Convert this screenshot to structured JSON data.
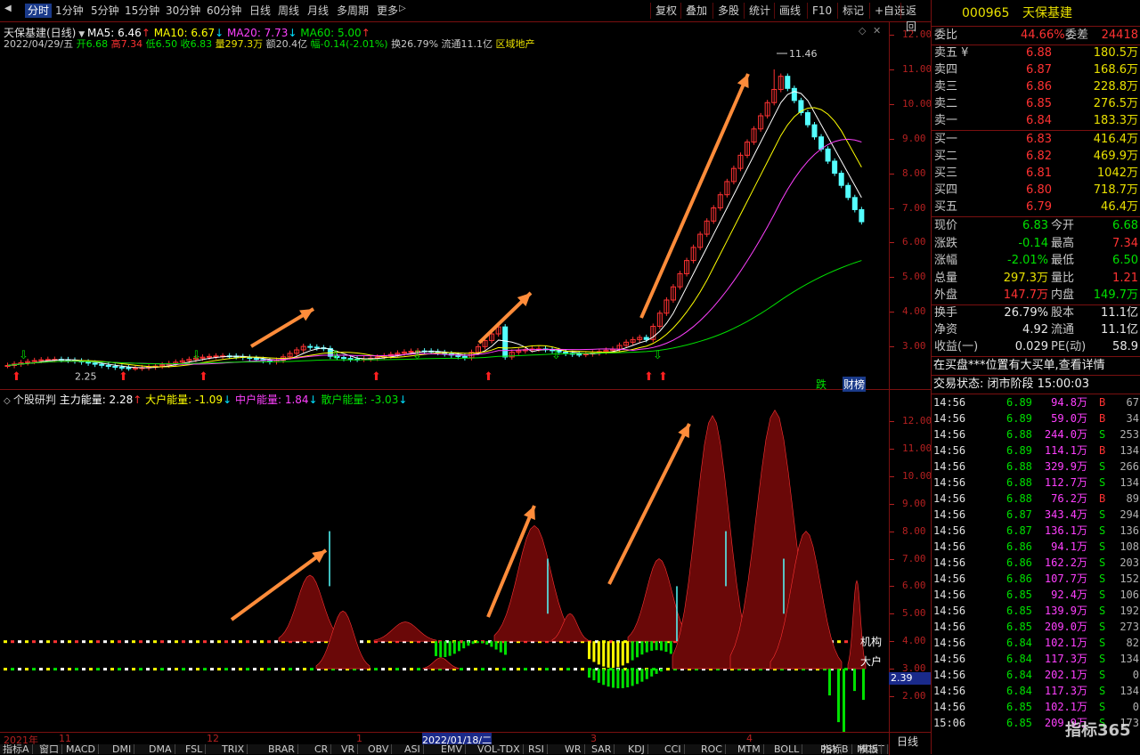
{
  "toolbar": {
    "periods": [
      "分时",
      "1分钟",
      "5分钟",
      "15分钟",
      "30分钟",
      "60分钟",
      "日线",
      "周线",
      "月线",
      "多周期",
      "更多"
    ],
    "active_period": "分时",
    "buttons": [
      "复权",
      "叠加",
      "多股",
      "统计",
      "画线",
      "F10",
      "标记",
      "+自选",
      "返回"
    ]
  },
  "chart": {
    "title": "天保基建(日线)",
    "ma": [
      {
        "label": "MA5: 6.46",
        "arrow": "↑",
        "color": "#ffffff"
      },
      {
        "label": "MA10: 6.67",
        "arrow": "↓",
        "color": "#ffff00"
      },
      {
        "label": "MA20: 7.73",
        "arrow": "↓",
        "color": "#ff40ff"
      },
      {
        "label": "MA60: 5.00",
        "arrow": "↑",
        "color": "#00e000"
      }
    ],
    "info": [
      {
        "t": "2022/04/29/五 ",
        "c": "#c8c8c8"
      },
      {
        "t": "开6.68 ",
        "c": "#00e000"
      },
      {
        "t": "高7.34 ",
        "c": "#ff3232"
      },
      {
        "t": "低6.50 ",
        "c": "#00e000"
      },
      {
        "t": "收6.83 ",
        "c": "#00e000"
      },
      {
        "t": "量297.3万 ",
        "c": "#e8e000"
      },
      {
        "t": "额20.4亿 ",
        "c": "#c8c8c8"
      },
      {
        "t": "幅-0.14(-2.01%) ",
        "c": "#00e000"
      },
      {
        "t": "换26.79% ",
        "c": "#c8c8c8"
      },
      {
        "t": "流通11.1亿 ",
        "c": "#c8c8c8"
      },
      {
        "t": "区域地产",
        "c": "#e8e000"
      }
    ],
    "price_ticks": [
      "12.00",
      "11.00",
      "10.00",
      "9.00",
      "8.00",
      "7.00",
      "6.00",
      "5.00",
      "4.00",
      "3.00"
    ],
    "high_label": "11.46",
    "low_label": "2.25",
    "tag_die": "跌",
    "tag_bang": "财榜"
  },
  "indicator": {
    "name": "个股研判",
    "lines": [
      {
        "label": "主力能量: 2.28",
        "arrow": "↑",
        "color": "#ffffff"
      },
      {
        "label": "大户能量: -1.09",
        "arrow": "↓",
        "color": "#ffff00"
      },
      {
        "label": "中户能量: 1.84",
        "arrow": "↓",
        "color": "#ff40ff"
      },
      {
        "label": "散户能量: -3.03",
        "arrow": "↓",
        "color": "#00e000"
      }
    ],
    "ticks": [
      "12.00",
      "11.00",
      "10.00",
      "9.00",
      "8.00",
      "7.00",
      "6.00",
      "5.00",
      "4.00",
      "3.00",
      "2.00"
    ],
    "label_jigou": "机构",
    "label_dahu": "大户",
    "current_value": "2.39"
  },
  "date_axis": {
    "ticks": [
      "2021年",
      "11",
      "12",
      "1",
      "2022/01/18/二",
      "3",
      "4"
    ],
    "right_label": "日线"
  },
  "indicator_tabs": [
    "指标A",
    "窗口",
    "MACD",
    "DMI",
    "DMA",
    "FSL",
    "TRIX",
    "BRAR",
    "CR",
    "VR",
    "OBV",
    "ASI",
    "EMV",
    "VOL-TDX",
    "RSI",
    "WR",
    "SAR",
    "KDJ",
    "CCI",
    "ROC",
    "MTM",
    "BOLL",
    "PSY",
    "MCST",
    "更多",
    "设置",
    "指标B",
    "模板"
  ],
  "quote": {
    "code": "000965",
    "name": "天保基建",
    "weibi_label": "委比",
    "weibi_value": "44.66%",
    "weicha_label": "委差",
    "weicha_value": "24418",
    "sell": [
      {
        "label": "卖五 ¥",
        "price": "6.88",
        "vol": "180.5万"
      },
      {
        "label": "卖四",
        "price": "6.87",
        "vol": "168.6万"
      },
      {
        "label": "卖三",
        "price": "6.86",
        "vol": "228.8万"
      },
      {
        "label": "卖二",
        "price": "6.85",
        "vol": "276.5万"
      },
      {
        "label": "卖一",
        "price": "6.84",
        "vol": "183.3万"
      }
    ],
    "buy": [
      {
        "label": "买一",
        "price": "6.83",
        "vol": "416.4万"
      },
      {
        "label": "买二",
        "price": "6.82",
        "vol": "469.9万"
      },
      {
        "label": "买三",
        "price": "6.81",
        "vol": "1042万"
      },
      {
        "label": "买四",
        "price": "6.80",
        "vol": "718.7万"
      },
      {
        "label": "买五",
        "price": "6.79",
        "vol": "46.4万"
      }
    ],
    "stats": [
      {
        "l1": "现价",
        "v1": "6.83",
        "c1": "#00e000",
        "l2": "今开",
        "v2": "6.68",
        "c2": "#00e000"
      },
      {
        "l1": "涨跌",
        "v1": "-0.14",
        "c1": "#00e000",
        "l2": "最高",
        "v2": "7.34",
        "c2": "#ff3232"
      },
      {
        "l1": "涨幅",
        "v1": "-2.01%",
        "c1": "#00e000",
        "l2": "最低",
        "v2": "6.50",
        "c2": "#00e000"
      },
      {
        "l1": "总量",
        "v1": "297.3万",
        "c1": "#e8e000",
        "l2": "量比",
        "v2": "1.21",
        "c2": "#ff3232"
      },
      {
        "l1": "外盘",
        "v1": "147.7万",
        "c1": "#ff3232",
        "l2": "内盘",
        "v2": "149.7万",
        "c2": "#00e000"
      }
    ],
    "stats2": [
      {
        "l1": "换手",
        "v1": "26.79%",
        "l2": "股本",
        "v2": "11.1亿"
      },
      {
        "l1": "净资",
        "v1": "4.92",
        "l2": "流通",
        "v2": "11.1亿"
      },
      {
        "l1": "收益(一)",
        "v1": "0.029",
        "l2": "PE(动)",
        "v2": "58.9"
      }
    ],
    "notice": "在买盘***位置有大买单,查看详情",
    "trade_status": "交易状态: 闭市阶段 15:00:03",
    "ticks": [
      {
        "t": "14:56",
        "p": "6.89",
        "v": "94.8万",
        "bs": "B",
        "n": "67"
      },
      {
        "t": "14:56",
        "p": "6.89",
        "v": "59.0万",
        "bs": "B",
        "n": "34"
      },
      {
        "t": "14:56",
        "p": "6.88",
        "v": "244.0万",
        "bs": "S",
        "n": "253"
      },
      {
        "t": "14:56",
        "p": "6.89",
        "v": "114.1万",
        "bs": "B",
        "n": "134"
      },
      {
        "t": "14:56",
        "p": "6.88",
        "v": "329.9万",
        "bs": "S",
        "n": "266"
      },
      {
        "t": "14:56",
        "p": "6.88",
        "v": "112.7万",
        "bs": "S",
        "n": "134"
      },
      {
        "t": "14:56",
        "p": "6.88",
        "v": "76.2万",
        "bs": "B",
        "n": "89"
      },
      {
        "t": "14:56",
        "p": "6.87",
        "v": "343.4万",
        "bs": "S",
        "n": "294"
      },
      {
        "t": "14:56",
        "p": "6.87",
        "v": "136.1万",
        "bs": "S",
        "n": "136"
      },
      {
        "t": "14:56",
        "p": "6.86",
        "v": "94.1万",
        "bs": "S",
        "n": "108"
      },
      {
        "t": "14:56",
        "p": "6.86",
        "v": "162.2万",
        "bs": "S",
        "n": "203"
      },
      {
        "t": "14:56",
        "p": "6.86",
        "v": "107.7万",
        "bs": "S",
        "n": "152"
      },
      {
        "t": "14:56",
        "p": "6.85",
        "v": "92.4万",
        "bs": "S",
        "n": "106"
      },
      {
        "t": "14:56",
        "p": "6.85",
        "v": "139.9万",
        "bs": "S",
        "n": "192"
      },
      {
        "t": "14:56",
        "p": "6.85",
        "v": "209.0万",
        "bs": "S",
        "n": "273"
      },
      {
        "t": "14:56",
        "p": "6.84",
        "v": "102.1万",
        "bs": "S",
        "n": "82"
      },
      {
        "t": "14:56",
        "p": "6.84",
        "v": "117.3万",
        "bs": "S",
        "n": "134"
      },
      {
        "t": "14:56",
        "p": "6.84",
        "v": "202.1万",
        "bs": "S",
        "n": "0"
      },
      {
        "t": "14:56",
        "p": "6.84",
        "v": "117.3万",
        "bs": "S",
        "n": "134"
      },
      {
        "t": "14:56",
        "p": "6.85",
        "v": "102.1万",
        "bs": "S",
        "n": "0"
      },
      {
        "t": "15:06",
        "p": "6.85",
        "v": "209.9万",
        "bs": "S",
        "n": "173"
      }
    ],
    "watermark": "指标365"
  }
}
